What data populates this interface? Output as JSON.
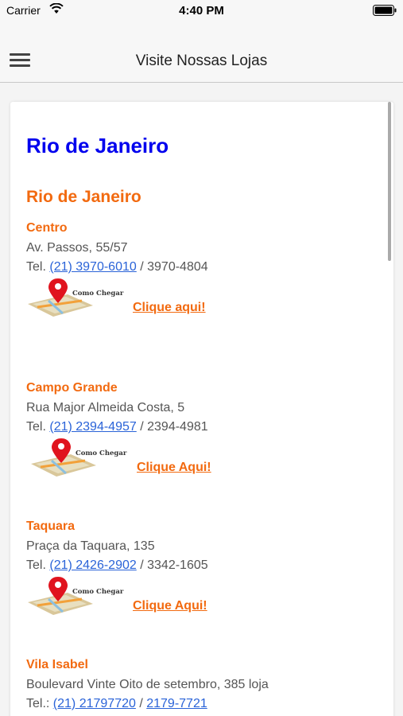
{
  "status_bar": {
    "carrier": "Carrier",
    "time": "4:40 PM"
  },
  "nav": {
    "title": "Visite Nossas Lojas"
  },
  "section": {
    "state": "Rio de Janeiro",
    "city": "Rio de Janeiro"
  },
  "stores": [
    {
      "name": "Centro",
      "address": "Av. Passos, 55/57",
      "tel_prefix": "Tel.",
      "phone_link": "(21) 3970-6010",
      "separator": " / ",
      "phone_secondary": "3970-4804",
      "map_caption": "Como Chegar",
      "cta": "Clique aqui!"
    },
    {
      "name": "Campo Grande",
      "address": "Rua Major Almeida Costa, 5",
      "tel_prefix": "Tel.",
      "phone_link": "(21) 2394-4957",
      "separator": " / ",
      "phone_secondary": "2394-4981",
      "map_caption": "Como Chegar",
      "cta": "Clique Aqui!"
    },
    {
      "name": "Taquara",
      "address": "Praça da Taquara, 135",
      "tel_prefix": "Tel.",
      "phone_link": "(21) 2426-2902",
      "separator": " / ",
      "phone_secondary": "3342-1605",
      "map_caption": "Como Chegar",
      "cta": "Clique Aqui!"
    },
    {
      "name": "Vila Isabel",
      "address": "Boulevard Vinte Oito de setembro, 385 loja",
      "tel_prefix": "Tel.:",
      "phone_link": "(21) 21797720",
      "separator": " / ",
      "phone_link_2": "2179-7721"
    }
  ],
  "colors": {
    "state_title": "#0000ee",
    "accent_orange": "#f26a10",
    "link_blue": "#2a63d8",
    "map_pin": "#e0141e"
  },
  "icons": {
    "menu": "hamburger-icon",
    "wifi": "wifi-icon",
    "battery": "battery-icon",
    "map": "map-pin-icon"
  }
}
